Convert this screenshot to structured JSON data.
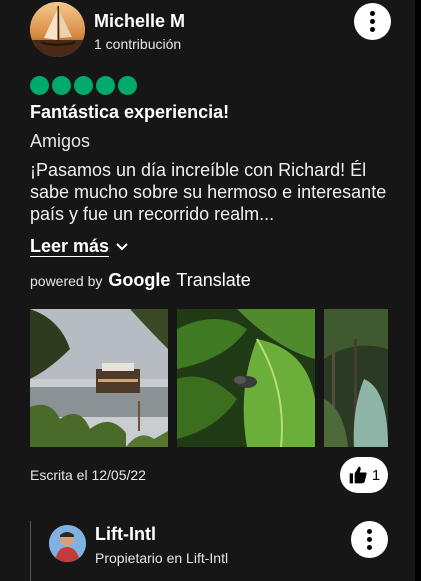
{
  "review": {
    "author": "Michelle M",
    "contributions": "1 contribución",
    "rating": 5,
    "title": "Fantástica experiencia!",
    "trip_type": "Amigos",
    "body": "¡Pasamos un día increíble con Richard! Él sabe mucho sobre su hermoso e interesante país y fue un recorrido realm...",
    "read_more": "Leer más",
    "written_date": "Escrita el 12/05/22",
    "helpful_count": "1"
  },
  "translate": {
    "powered_by": "powered by",
    "google": "Google",
    "translate": "Translate"
  },
  "owner_reply": {
    "name": "Lift-Intl",
    "role": "Propietario en Lift-Intl"
  },
  "colors": {
    "background": "#161616",
    "rating_bubble": "#00aa6c",
    "button_bg": "#ffffff"
  },
  "icons": {
    "more": "more-vertical-icon",
    "chevron": "chevron-down-icon",
    "like": "thumbs-up-icon"
  }
}
